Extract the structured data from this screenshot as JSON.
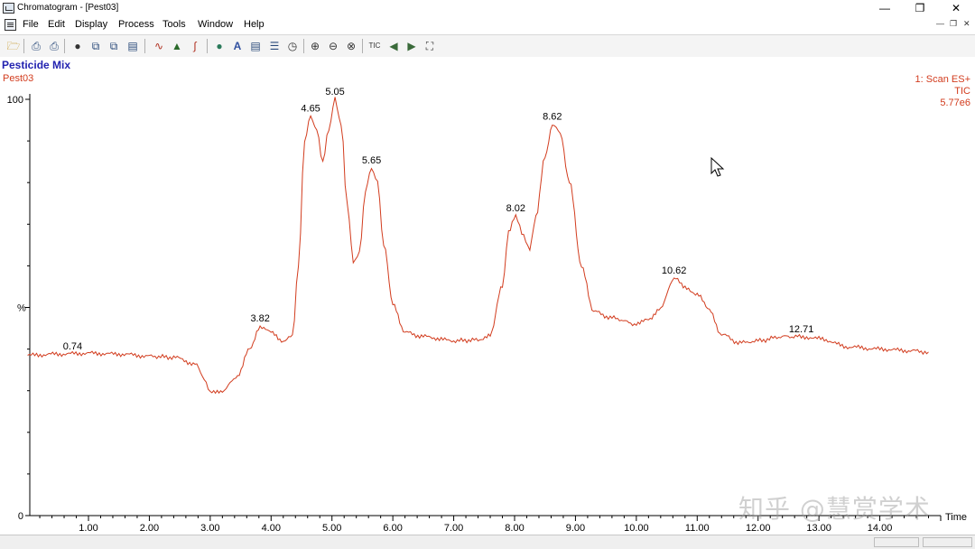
{
  "window": {
    "title": "Chromatogram - [Pest03]",
    "minimize_icon": "minimize-icon",
    "restore_icon": "restore-icon",
    "close_icon": "close-icon"
  },
  "menubar": {
    "items": [
      "File",
      "Edit",
      "Display",
      "Process",
      "Tools",
      "Window",
      "Help"
    ]
  },
  "toolbar": {
    "tools": [
      "open-icon",
      "print-icon",
      "print-preview-icon",
      "camera-icon",
      "copy-icon",
      "copy-picture-icon",
      "paste-icon",
      "chromatogram-icon",
      "peak-detect-icon",
      "integrate-icon",
      "globe-icon",
      "text-annotate-icon",
      "layout-icon",
      "smooth-icon",
      "timer-icon",
      "zoom-in-icon",
      "zoom-out-icon",
      "zoom-reset-icon",
      "tic-icon",
      "back-arrow-icon",
      "forward-arrow-icon",
      "fullscreen-icon"
    ],
    "tic_label": "TIC"
  },
  "document": {
    "title": "Pesticide Mix",
    "sample": "Pest03",
    "scan_label": "1: Scan ES+",
    "trace_label": "TIC",
    "intensity_label": "5.77e6"
  },
  "colors": {
    "trace": "#d23c1e",
    "title": "#2222b0",
    "axis": "#000000"
  },
  "chart_data": {
    "type": "line",
    "title": "Pesticide Mix",
    "xlabel": "Time",
    "ylabel": "%",
    "xlim": [
      0,
      15.3
    ],
    "ylim": [
      0,
      100
    ],
    "x_ticks": [
      1.0,
      2.0,
      3.0,
      4.0,
      5.0,
      6.0,
      7.0,
      8.0,
      9.0,
      10.0,
      11.0,
      12.0,
      13.0,
      14.0
    ],
    "x_tick_labels": [
      "1.00",
      "2.00",
      "3.00",
      "4.00",
      "5.00",
      "6.00",
      "7.00",
      "8.00",
      "9.00",
      "10.00",
      "11.00",
      "12.00",
      "13.00",
      "14.00"
    ],
    "y_ticks": [
      0,
      100
    ],
    "y_tick_labels": [
      "0",
      "100"
    ],
    "grid": false,
    "series": [
      {
        "name": "Pest03",
        "x": [
          0.0,
          0.5,
          1.0,
          1.5,
          2.0,
          2.4,
          2.75,
          2.9,
          3.0,
          3.2,
          3.45,
          3.65,
          3.82,
          4.0,
          4.2,
          4.35,
          4.45,
          4.55,
          4.65,
          4.75,
          4.85,
          4.95,
          5.05,
          5.15,
          5.25,
          5.35,
          5.45,
          5.55,
          5.65,
          5.75,
          5.85,
          6.0,
          6.2,
          6.5,
          7.0,
          7.4,
          7.6,
          7.8,
          7.9,
          8.02,
          8.15,
          8.25,
          8.35,
          8.5,
          8.62,
          8.75,
          8.9,
          9.1,
          9.3,
          9.6,
          10.0,
          10.2,
          10.4,
          10.62,
          10.8,
          11.0,
          11.2,
          11.4,
          11.7,
          12.0,
          12.4,
          12.71,
          13.0,
          13.5,
          14.0,
          14.5,
          14.8
        ],
        "y": [
          38.5,
          38.8,
          39.0,
          38.8,
          38.3,
          38.0,
          36.5,
          33.0,
          29.5,
          30.0,
          33.5,
          40.0,
          45.5,
          44.0,
          42.0,
          43.0,
          60.0,
          90.0,
          96.0,
          92.5,
          85.0,
          93.0,
          100.0,
          94.0,
          75.0,
          61.0,
          63.0,
          78.0,
          83.5,
          80.0,
          65.0,
          51.0,
          44.0,
          43.0,
          42.0,
          42.2,
          43.5,
          55.0,
          68.0,
          72.0,
          67.0,
          64.0,
          72.0,
          86.0,
          94.0,
          92.0,
          80.0,
          60.0,
          49.0,
          47.5,
          46.0,
          47.0,
          50.0,
          57.0,
          55.0,
          53.0,
          49.5,
          43.5,
          41.5,
          42.0,
          43.0,
          43.0,
          42.5,
          40.5,
          40.0,
          39.6,
          39.3
        ]
      }
    ],
    "peak_labels": [
      {
        "x": 0.74,
        "y": 38.8,
        "label": "0.74"
      },
      {
        "x": 3.82,
        "y": 45.5,
        "label": "3.82"
      },
      {
        "x": 4.65,
        "y": 96.0,
        "label": "4.65"
      },
      {
        "x": 5.05,
        "y": 100.0,
        "label": "5.05"
      },
      {
        "x": 5.65,
        "y": 83.5,
        "label": "5.65"
      },
      {
        "x": 8.02,
        "y": 72.0,
        "label": "8.02"
      },
      {
        "x": 8.62,
        "y": 94.0,
        "label": "8.62"
      },
      {
        "x": 10.62,
        "y": 57.0,
        "label": "10.62"
      },
      {
        "x": 12.71,
        "y": 43.0,
        "label": "12.71"
      }
    ]
  },
  "watermark": "知乎 @慧赏学术"
}
